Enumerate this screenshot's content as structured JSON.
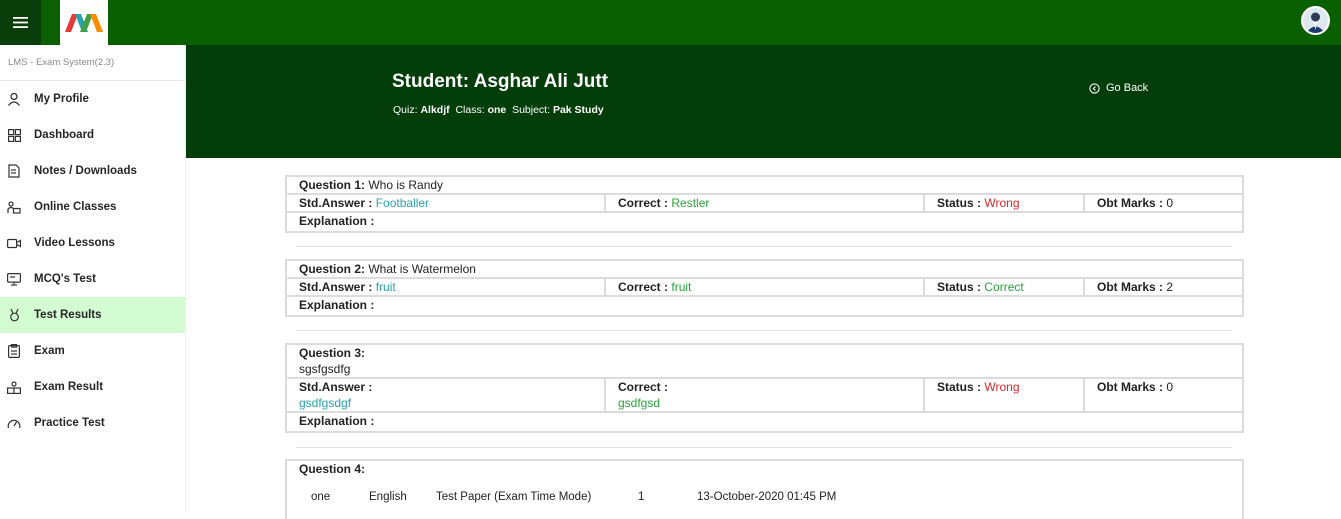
{
  "topbar": {
    "menu_icon": "hamburger-icon",
    "logo": "M",
    "avatar_icon": "user-avatar"
  },
  "sidebar": {
    "version": "LMS - Exam System(2.3)",
    "items": [
      {
        "label": "My Profile",
        "icon": "user-icon"
      },
      {
        "label": "Dashboard",
        "icon": "grid-icon"
      },
      {
        "label": "Notes / Downloads",
        "icon": "document-icon"
      },
      {
        "label": "Online Classes",
        "icon": "classes-icon"
      },
      {
        "label": "Video Lessons",
        "icon": "video-icon"
      },
      {
        "label": "MCQ's Test",
        "icon": "monitor-icon"
      },
      {
        "label": "Test Results",
        "icon": "award-icon",
        "active": true
      },
      {
        "label": "Exam",
        "icon": "clipboard-icon"
      },
      {
        "label": "Exam Result",
        "icon": "result-icon"
      },
      {
        "label": "Practice Test",
        "icon": "gauge-icon"
      }
    ]
  },
  "header": {
    "student": "Student: Asghar Ali Jutt",
    "quiz_label": "Quiz:",
    "quiz": "Alkdjf",
    "class_label": "Class:",
    "class": "one",
    "subject_label": "Subject:",
    "subject": "Pak Study",
    "go_back": "Go Back"
  },
  "labels": {
    "std_answer": "Std.Answer :",
    "correct": "Correct :",
    "status": "Status :",
    "obt_marks": "Obt Marks :",
    "explanation": "Explanation :"
  },
  "questions": [
    {
      "label": "Question 1:",
      "text": "Who is Randy",
      "std_answer": "Footballer",
      "correct": "Restler",
      "status": "Wrong",
      "marks": "0"
    },
    {
      "label": "Question 2:",
      "text": "What is Watermelon",
      "std_answer": "fruit",
      "correct": "fruit",
      "status": "Correct",
      "marks": "2"
    },
    {
      "label": "Question 3:",
      "text": "sgsfgsdfg",
      "std_answer": "gsdfgsdgf",
      "correct": "gsdfgsd",
      "status": "Wrong",
      "marks": "0"
    },
    {
      "label": "Question 4:"
    }
  ],
  "exam_row": [
    "one",
    "English",
    "Test Paper (Exam Time Mode)",
    "1",
    "13-October-2020 01:45 PM"
  ],
  "colors": {
    "topbar": "#0a6000",
    "header": "#033d0a",
    "active_item": "#d4fcd2",
    "answer": "#2aa3b0",
    "correct": "#28a23c",
    "wrong": "#d62a2a"
  }
}
